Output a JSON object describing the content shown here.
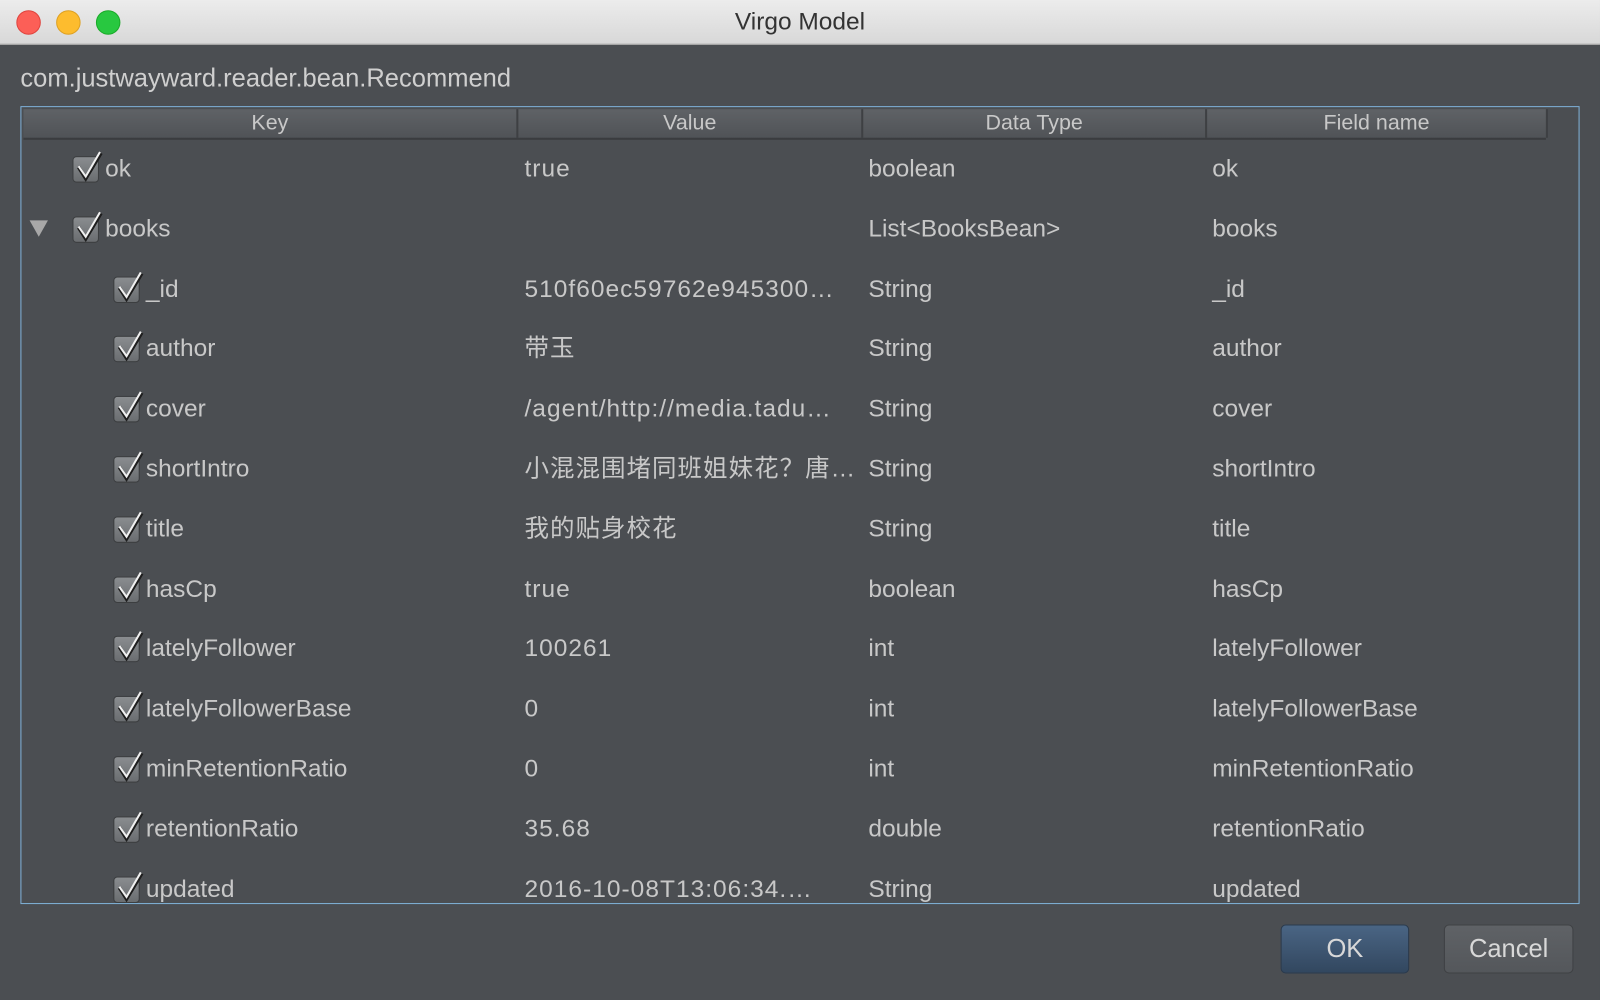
{
  "window": {
    "title": "Virgo Model"
  },
  "class_name": "com.justwayward.reader.bean.Recommend",
  "columns": [
    "Key",
    "Value",
    "Data Type",
    "Field name"
  ],
  "rows": [
    {
      "key": "ok",
      "value": "true",
      "type": "boolean",
      "field": "ok",
      "level": 0,
      "checked": true
    },
    {
      "key": "books",
      "value": "",
      "type": "List<BooksBean>",
      "field": "books",
      "level": 0,
      "checked": true,
      "expanded": true
    },
    {
      "key": "_id",
      "value": "510f60ec59762e945300…",
      "type": "String",
      "field": "_id",
      "level": 1,
      "checked": true
    },
    {
      "key": "author",
      "value": "带玉",
      "type": "String",
      "field": "author",
      "level": 1,
      "checked": true
    },
    {
      "key": "cover",
      "value": "/agent/http://media.tadu…",
      "type": "String",
      "field": "cover",
      "level": 1,
      "checked": true
    },
    {
      "key": "shortIntro",
      "value": "小混混围堵同班姐妹花？唐…",
      "type": "String",
      "field": "shortIntro",
      "level": 1,
      "checked": true
    },
    {
      "key": "title",
      "value": "我的贴身校花",
      "type": "String",
      "field": "title",
      "level": 1,
      "checked": true
    },
    {
      "key": "hasCp",
      "value": "true",
      "type": "boolean",
      "field": "hasCp",
      "level": 1,
      "checked": true
    },
    {
      "key": "latelyFollower",
      "value": "100261",
      "type": "int",
      "field": "latelyFollower",
      "level": 1,
      "checked": true
    },
    {
      "key": "latelyFollowerBase",
      "value": "0",
      "type": "int",
      "field": "latelyFollowerBase",
      "level": 1,
      "checked": true
    },
    {
      "key": "minRetentionRatio",
      "value": "0",
      "type": "int",
      "field": "minRetentionRatio",
      "level": 1,
      "checked": true
    },
    {
      "key": "retentionRatio",
      "value": "35.68",
      "type": "double",
      "field": "retentionRatio",
      "level": 1,
      "checked": true
    },
    {
      "key": "updated",
      "value": "2016-10-08T13:06:34.…",
      "type": "String",
      "field": "updated",
      "level": 1,
      "checked": true
    }
  ],
  "buttons": {
    "ok": "OK",
    "cancel": "Cancel"
  },
  "colors": {
    "accent": "#7fb1d8",
    "ok_button": "#3b5675"
  }
}
